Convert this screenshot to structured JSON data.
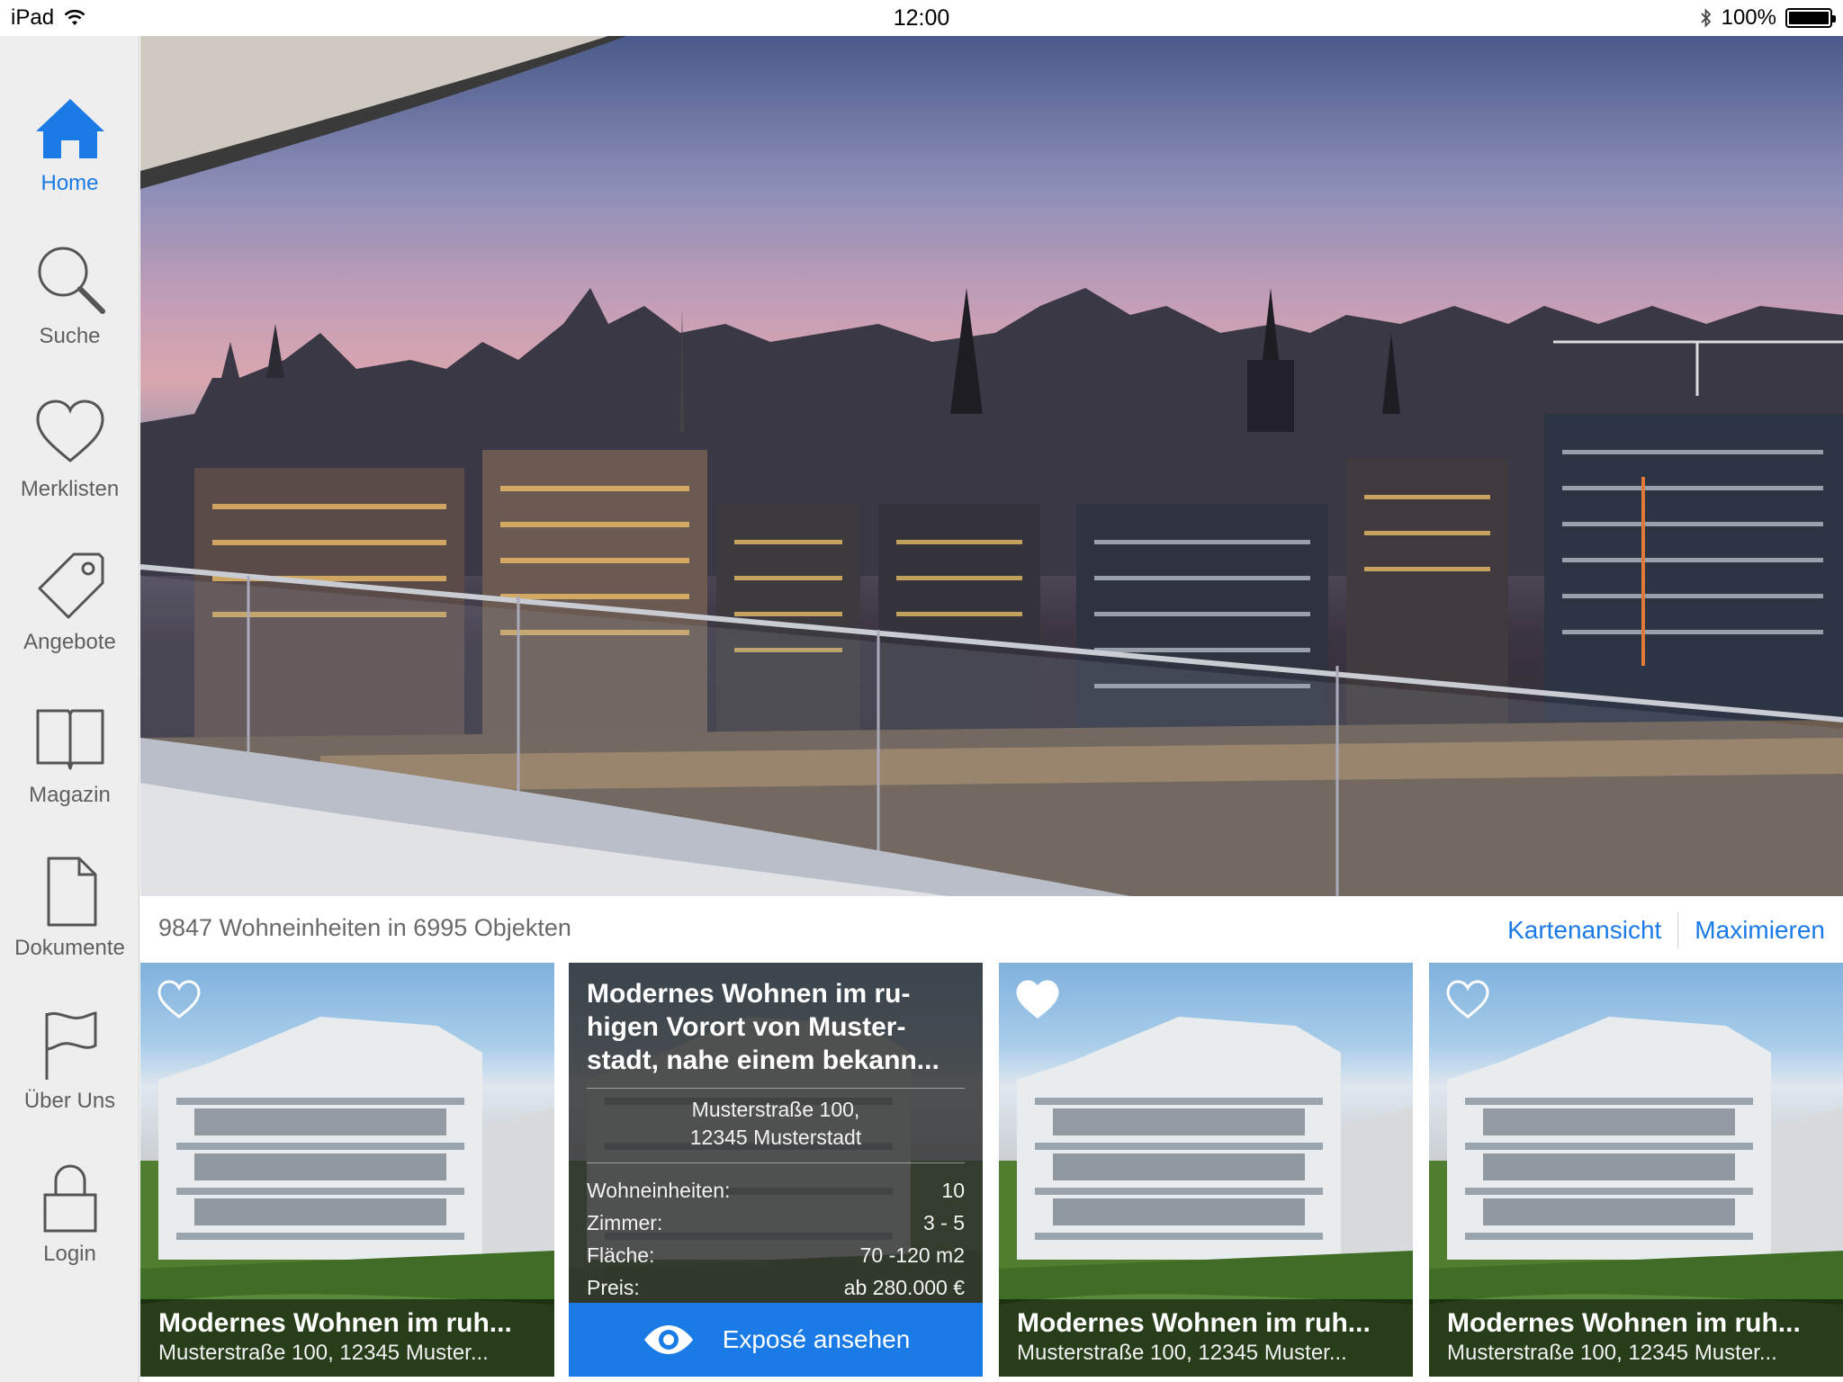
{
  "status_bar": {
    "device": "iPad",
    "time": "12:00",
    "battery": "100%"
  },
  "sidebar": {
    "items": [
      {
        "label": "Home",
        "icon": "home-icon",
        "active": true
      },
      {
        "label": "Suche",
        "icon": "search-icon",
        "active": false
      },
      {
        "label": "Merklisten",
        "icon": "heart-icon",
        "active": false
      },
      {
        "label": "Angebote",
        "icon": "tag-icon",
        "active": false
      },
      {
        "label": "Magazin",
        "icon": "book-icon",
        "active": false
      },
      {
        "label": "Dokumente",
        "icon": "document-icon",
        "active": false
      },
      {
        "label": "Über Uns",
        "icon": "flag-icon",
        "active": false
      },
      {
        "label": "Login",
        "icon": "lock-icon",
        "active": false
      }
    ],
    "accent": "#1a7be6"
  },
  "infobar": {
    "count_text": "9847 Wohneinheiten in 6995 Objekten",
    "map_view": "Kartenansicht",
    "maximize": "Maximieren"
  },
  "cards": [
    {
      "title": "Modernes Wohnen im ruh...",
      "subtitle": "Musterstraße 100, 12345 Muster...",
      "favorite": false
    },
    {
      "title": "Modernes Wohnen im ru-higen Vorort von Muster-stadt, nahe einem bekann...",
      "address_line1": "Musterstraße 100,",
      "address_line2": "12345 Musterstadt",
      "rows": [
        {
          "label": "Wohneinheiten:",
          "value": "10"
        },
        {
          "label": "Zimmer:",
          "value": "3 - 5"
        },
        {
          "label": "Fläche:",
          "value": "70 -120 m2"
        },
        {
          "label": "Preis:",
          "value": "ab 280.000 €"
        }
      ],
      "cta": "Exposé ansehen"
    },
    {
      "title": "Modernes Wohnen im ruh...",
      "subtitle": "Musterstraße 100, 12345 Muster...",
      "favorite": true
    },
    {
      "title": "Modernes Wohnen im ruh...",
      "subtitle": "Musterstraße 100, 12345 Muster...",
      "favorite": false
    }
  ]
}
